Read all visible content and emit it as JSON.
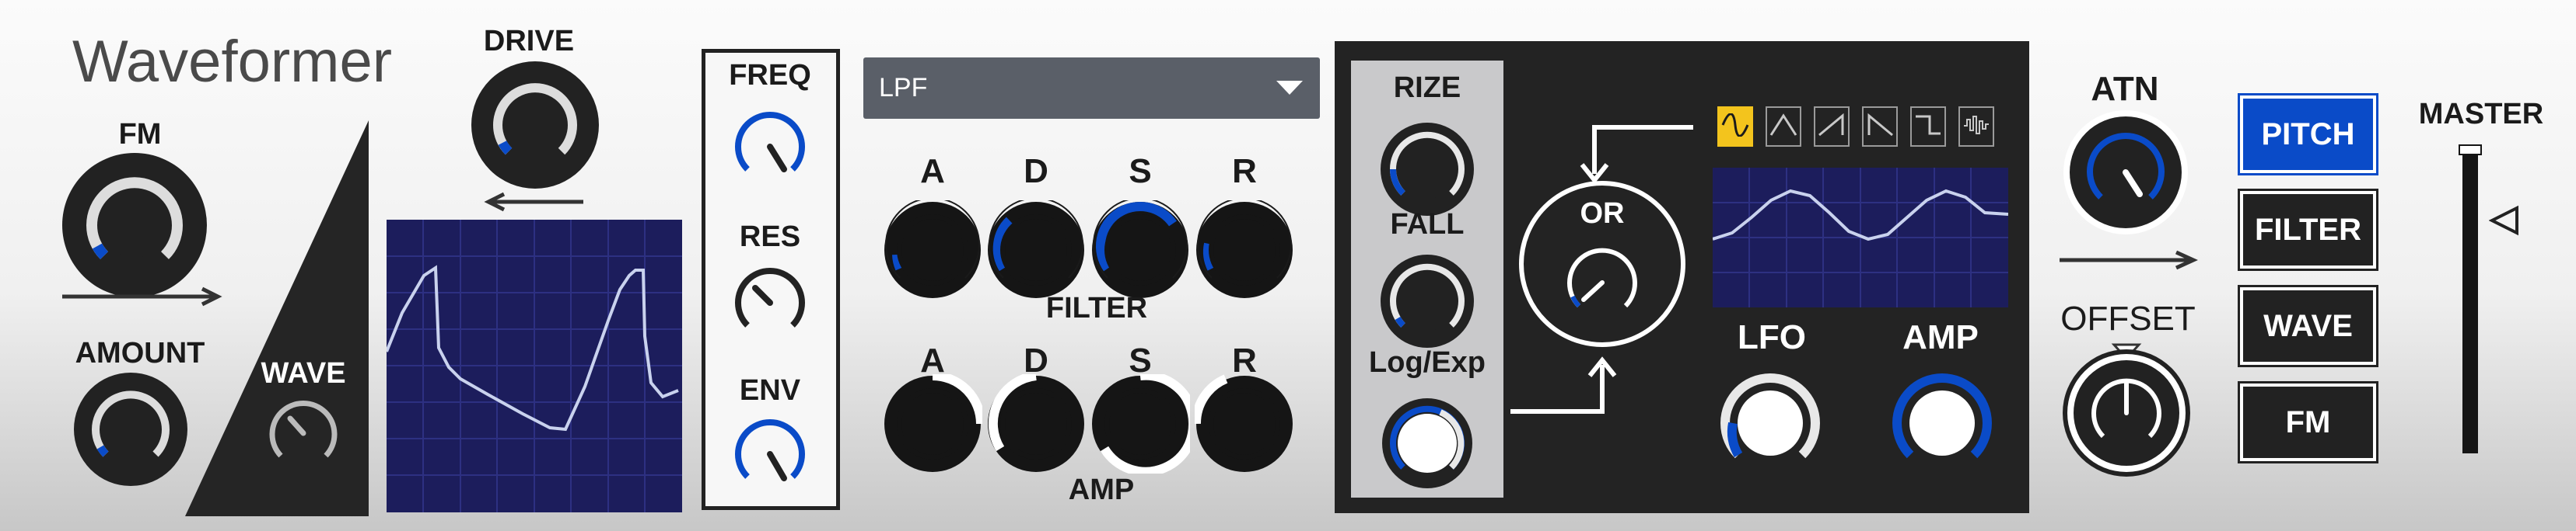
{
  "app": {
    "title": "Waveformer"
  },
  "colors": {
    "accent": "#0a4bc8",
    "panel_dark": "#232323",
    "screen": "#1c1d5c",
    "selected_shape": "#f3c41d"
  },
  "osc": {
    "fm_label": "FM",
    "amount_label": "AMOUNT",
    "wave_label": "WAVE",
    "drive_label": "DRIVE"
  },
  "filter_cutoff": {
    "freq_label": "FREQ",
    "res_label": "RES",
    "env_label": "ENV"
  },
  "filter_type": {
    "selected": "LPF"
  },
  "env": {
    "adsr_labels": [
      "A",
      "D",
      "S",
      "R"
    ],
    "filter_label": "FILTER",
    "amp_label": "AMP"
  },
  "mod": {
    "rize_label": "RIZE",
    "fall_label": "FALL",
    "logexp_label": "Log/Exp",
    "or_label": "OR",
    "lfo_label": "LFO",
    "amp_label": "AMP",
    "lfo_shapes": [
      "sine-wave-icon",
      "triangle-wave-icon",
      "saw-up-wave-icon",
      "saw-down-wave-icon",
      "square-wave-icon",
      "random-wave-icon"
    ],
    "lfo_shape_selected": "sine-wave-icon"
  },
  "destination": {
    "atn_label": "ATN",
    "offset_label": "OFFSET",
    "buttons": [
      "PITCH",
      "FILTER",
      "WAVE",
      "FM"
    ],
    "active": "PITCH"
  },
  "master": {
    "label": "MASTER"
  }
}
